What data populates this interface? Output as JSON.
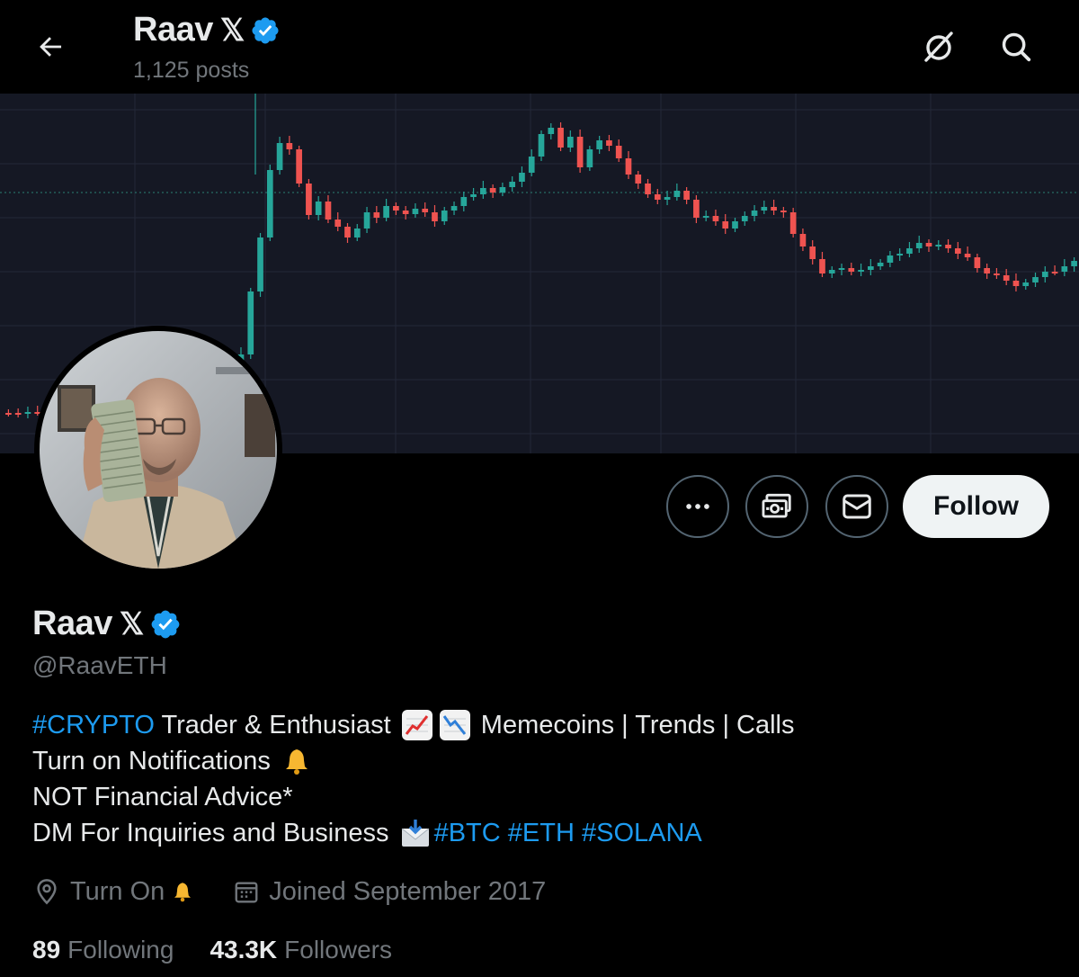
{
  "header": {
    "display_name": "Raav",
    "x_suffix": "𝕏",
    "posts_count": "1,125 posts"
  },
  "actions": {
    "follow_label": "Follow"
  },
  "profile": {
    "display_name": "Raav",
    "x_suffix": "𝕏",
    "handle": "@RaavETH",
    "bio": {
      "line1_hashtag": "#CRYPTO",
      "line1_text": " Trader & Enthusiast ",
      "line1_tail": " Memecoins | Trends | Calls",
      "line2_text": "Turn on Notifications ",
      "line3_text": "NOT Financial Advice*",
      "line4_text": "DM For Inquiries and Business ",
      "line4_hashtags": [
        "#BTC",
        "#ETH",
        "#SOLANA"
      ]
    },
    "location": "Turn On",
    "joined": "Joined September 2017",
    "following_count": "89",
    "following_label": "Following",
    "followers_count": "43.3K",
    "followers_label": "Followers"
  },
  "colors": {
    "accent": "#1d9bf0",
    "candle_up": "#26a69a",
    "candle_down": "#ef5350",
    "banner_bg": "#151824"
  },
  "icons": {
    "back": "arrow-left-icon",
    "grok": "grok-icon",
    "search": "search-icon",
    "more": "more-dots-icon",
    "tip": "money-icon",
    "message": "envelope-icon",
    "location": "location-pin-icon",
    "calendar": "calendar-icon"
  }
}
